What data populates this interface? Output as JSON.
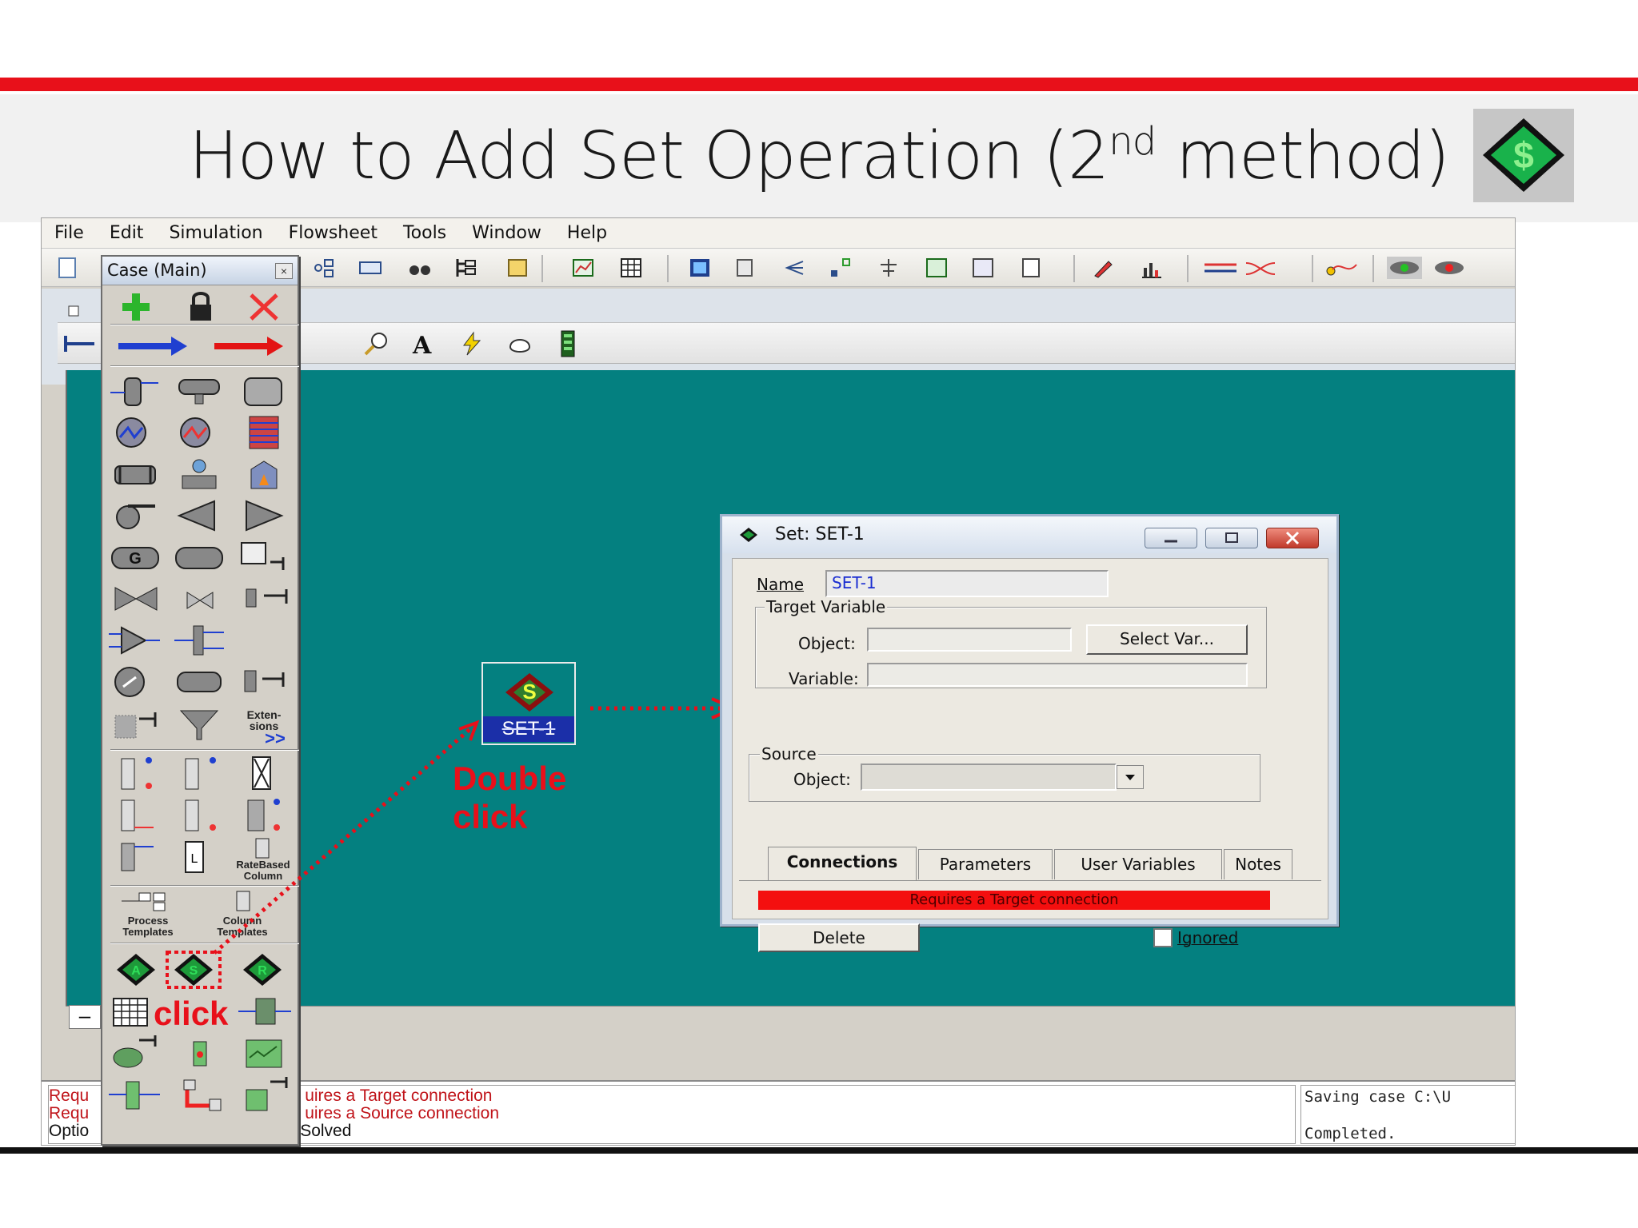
{
  "slide": {
    "title_before": "How to Add Set Operation (2",
    "title_sup": "nd",
    "title_after": " method)",
    "logo_icon": "set-operation-diamond-icon",
    "accent_color": "#e8101a"
  },
  "app": {
    "menu": [
      "File",
      "Edit",
      "Simulation",
      "Flowsheet",
      "Tools",
      "Window",
      "Help"
    ]
  },
  "palette": {
    "title": "Case (Main)",
    "labels": {
      "extensions": "Exten-\nsions",
      "extensions_more": ">>",
      "ratebased": "RateBased\nColumn",
      "process_templates": "Process\nTemplates",
      "column_templates": "Column\nTemplates"
    },
    "logic_icons": [
      "A",
      "S",
      "R"
    ]
  },
  "flowsheet": {
    "object_label": "SET-1",
    "object_icon_letter": "S"
  },
  "annotations": {
    "double_click_line1": "Double",
    "double_click_line2": "click",
    "click": "click"
  },
  "dialog": {
    "title": "Set: SET-1",
    "name_label": "Name",
    "name_value": "SET-1",
    "target_group": "Target Variable",
    "object_label": "Object:",
    "select_var_button": "Select Var...",
    "variable_label": "Variable:",
    "source_group": "Source",
    "source_object_label": "Object:",
    "tabs": [
      "Connections",
      "Parameters",
      "User Variables",
      "Notes"
    ],
    "active_tab": "Connections",
    "status_message": "Requires a Target connection",
    "delete_button": "Delete",
    "ignored_label": "Ignored",
    "ignored_checked": false
  },
  "status": {
    "left_rows": [
      {
        "prefix": "Requ",
        "message": "uires a Target connection"
      },
      {
        "prefix": "Requ",
        "message": "uires a Source connection"
      },
      {
        "prefix": "Optio",
        "message": "Solved"
      }
    ],
    "right_line1": "Saving case C:\\U",
    "right_line2": "Completed."
  }
}
